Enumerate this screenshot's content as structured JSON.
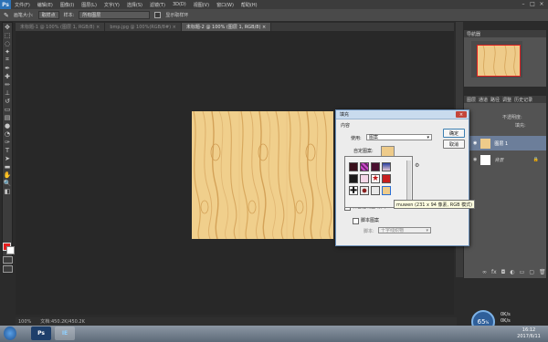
{
  "app": {
    "logo": "Ps"
  },
  "menubar": {
    "items": [
      "文件(F)",
      "编辑(E)",
      "图像(I)",
      "图层(L)",
      "文字(Y)",
      "选择(S)",
      "滤镜(T)",
      "3D(D)",
      "视图(V)",
      "窗口(W)",
      "帮助(H)"
    ],
    "window_controls": [
      "–",
      "□",
      "×"
    ]
  },
  "options_bar": {
    "brush_size_label": "画笔大小:",
    "brush_size_value": "取样点",
    "sample_label": "样本:",
    "sample_value": "所有图层",
    "show_ring_label": "显示取样环"
  },
  "tabs": [
    {
      "label": "未标题-1 @ 100% (图层 1, RGB/8) ×"
    },
    {
      "label": "bmp.jpg @ 100%(RGB/8#) ×"
    },
    {
      "label": "未标题-2 @ 100% (图层 1, RGB/8) ×"
    }
  ],
  "status": {
    "zoom": "100%",
    "doc": "文档:450.2K/450.2K"
  },
  "navigator": {
    "title": "导航器"
  },
  "layers_panel": {
    "tabs": [
      "图层",
      "通道",
      "路径",
      "调整",
      "历史记录"
    ],
    "opacity_label": "不透明度:",
    "fill_label": "填充:",
    "layers": [
      {
        "name": "图层 1",
        "selected": true
      },
      {
        "name": "背景",
        "selected": false
      }
    ]
  },
  "dialog": {
    "title": "填充",
    "content_label": "内容",
    "use_label": "使用:",
    "use_value": "图案",
    "custom_pattern_label": "自定图案:",
    "ok_label": "确定",
    "cancel_label": "取消",
    "preserve_transparency_label": "保留透明区域(P)",
    "script_pattern_label": "脚本图案",
    "script_label": "脚本:",
    "script_value": "十字线织物",
    "close_label": "×"
  },
  "tooltip": {
    "text": "muwen (231 x 94 像素, RGB 模式)"
  },
  "taskbar": {
    "apps": [
      "Ps",
      "IE"
    ],
    "time": "16:12",
    "date": "2017/6/11"
  },
  "gauge": {
    "value": "65",
    "unit": "%",
    "up": "0K/s",
    "down": "0K/s"
  },
  "colors": {
    "foreground": "#e31d1d",
    "background": "#ffffff",
    "selection": "#6c7e9a"
  }
}
